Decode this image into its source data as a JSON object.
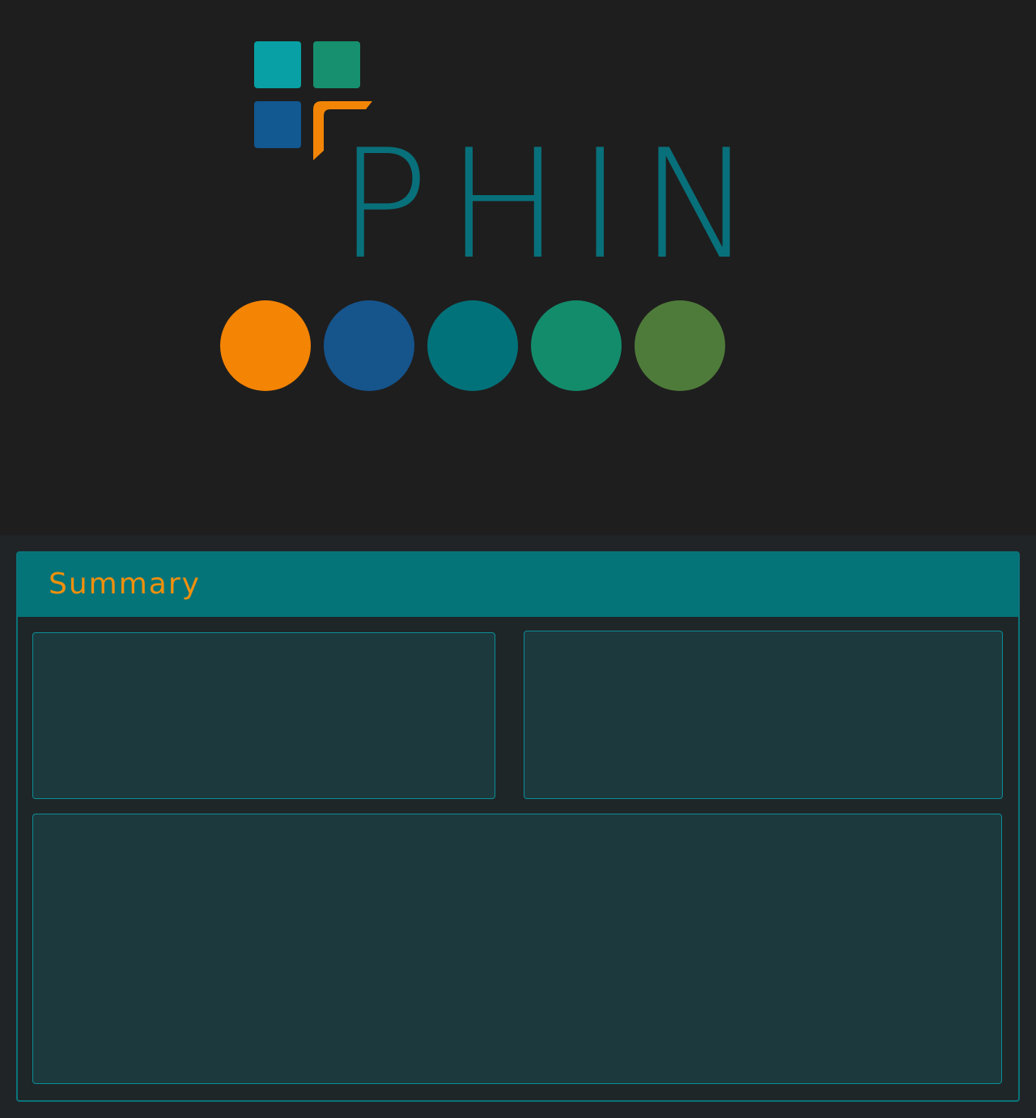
{
  "brand": {
    "name": "PHIN",
    "colors": {
      "teal_light": "#08a0a4",
      "green_teal": "#16906f",
      "blue": "#125891",
      "orange": "#f28506",
      "wordmark": "#08707a"
    }
  },
  "palette": [
    {
      "name": "orange",
      "color": "#f48404"
    },
    {
      "name": "blue",
      "color": "#16548c"
    },
    {
      "name": "teal",
      "color": "#02727a"
    },
    {
      "name": "green",
      "color": "#138c6c"
    },
    {
      "name": "olive-green",
      "color": "#4f7b3a"
    }
  ],
  "summary": {
    "title": "Summary"
  },
  "theme": {
    "background": "#1e1e1e",
    "panel_header": "#047479",
    "panel_border": "#0a747a",
    "card_fill": "#1c393d",
    "accent_text": "#f0900d"
  }
}
